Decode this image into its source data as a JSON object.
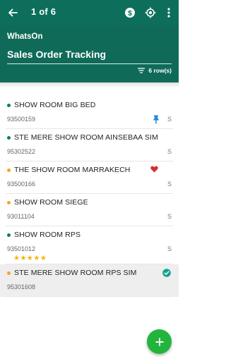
{
  "appbar": {
    "counter": "1 of 6",
    "actions": [
      "dollar-icon",
      "target-icon",
      "more-vert-icon"
    ]
  },
  "hero": {
    "app_name": "WhatsOn",
    "title": "Sales Order Tracking",
    "rows": "6 row(s)"
  },
  "colors": {
    "header": "#0d6e5b",
    "dot_green": "#0d7d6a",
    "dot_orange": "#f5a623",
    "fab": "#22b53d",
    "pin": "#1e88e5",
    "heart": "#d32f2f",
    "check": "#12a38b",
    "star": "#f5b400"
  },
  "items": [
    {
      "name": "SHOW ROOM BIG BED",
      "code": "93500159",
      "flag": "S",
      "dot": "green",
      "badge": "pin-icon"
    },
    {
      "name": "STE MERE SHOW ROOM AINSEBAA SIM",
      "code": "95302522",
      "flag": "S",
      "dot": "green"
    },
    {
      "name": "THE SHOW ROOM MARRAKECH",
      "code": "93500166",
      "flag": "S",
      "dot": "orange",
      "badge": "heart-icon"
    },
    {
      "name": "SHOW ROOM SIEGE",
      "code": "93011104",
      "flag": "S",
      "dot": "orange"
    },
    {
      "name": "SHOW ROOM RPS",
      "code": "93501012",
      "flag": "S",
      "dot": "green",
      "rating": "★★★★★"
    },
    {
      "name": "STE MERE SHOW ROOM RPS SIM",
      "code": "95301608",
      "flag": "",
      "dot": "orange",
      "badge": "check-circle-icon",
      "selected": true
    }
  ]
}
